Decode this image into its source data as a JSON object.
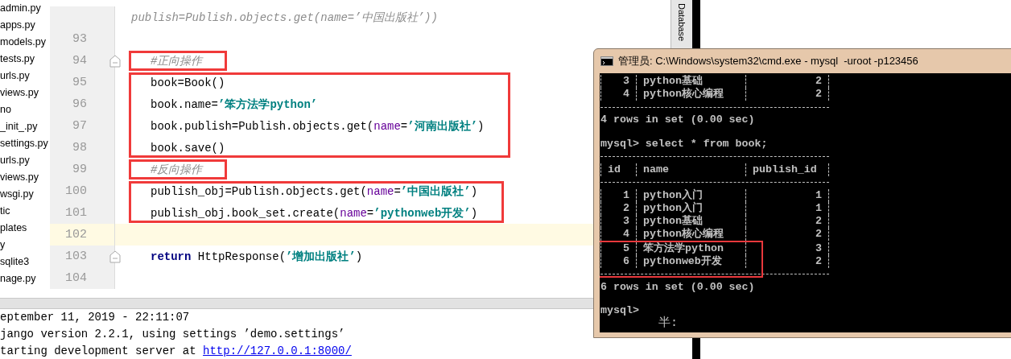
{
  "project_tree": {
    "items": [
      "admin.py",
      "apps.py",
      "models.py",
      "tests.py",
      "urls.py",
      "views.py",
      "no",
      "_init_.py",
      "settings.py",
      "urls.py",
      "views.py",
      "wsgi.py",
      "tic",
      "plates",
      "y",
      "sqlite3",
      "nage.py"
    ]
  },
  "editor": {
    "blocks": [
      {
        "boxed": false,
        "lines": [
          {
            "fold": false,
            "current": false,
            "segments": [
              {
                "kind": "comment",
                "text": "publish=Publish.objects.get(name=’中国出版社’))"
              }
            ]
          },
          {
            "number": "93",
            "fold": false,
            "current": false
          }
        ]
      },
      {
        "boxed": true,
        "lines": [
          {
            "number": "94",
            "fold": true,
            "current": false,
            "segments": [
              {
                "kind": "comment",
                "text": "#正向操作"
              }
            ]
          }
        ]
      },
      {
        "boxed": true,
        "lines": [
          {
            "number": "95",
            "fold": false,
            "current": false,
            "segments": [
              {
                "kind": "plain",
                "text": "book=Book()"
              }
            ]
          },
          {
            "number": "96",
            "fold": false,
            "current": false,
            "segments": [
              {
                "kind": "plain",
                "text": "book.name="
              },
              {
                "kind": "string",
                "text": "’笨方法学python’"
              }
            ]
          },
          {
            "number": "97",
            "fold": false,
            "current": false,
            "segments": [
              {
                "kind": "plain",
                "text": "book.publish=Publish.objects.get("
              },
              {
                "kind": "param",
                "text": "name"
              },
              {
                "kind": "plain",
                "text": "="
              },
              {
                "kind": "string",
                "text": "’河南出版社’"
              },
              {
                "kind": "plain",
                "text": ")"
              }
            ]
          },
          {
            "number": "98",
            "fold": false,
            "current": false,
            "segments": [
              {
                "kind": "plain",
                "text": "book.save()"
              }
            ]
          }
        ]
      },
      {
        "boxed": true,
        "lines": [
          {
            "number": "99",
            "fold": false,
            "current": false,
            "segments": [
              {
                "kind": "comment",
                "text": "#反向操作"
              }
            ]
          }
        ]
      },
      {
        "boxed": true,
        "lines": [
          {
            "number": "100",
            "fold": false,
            "current": false,
            "segments": [
              {
                "kind": "plain",
                "text": "publish_obj=Publish.objects.get("
              },
              {
                "kind": "param",
                "text": "name"
              },
              {
                "kind": "plain",
                "text": "="
              },
              {
                "kind": "string",
                "text": "’中国出版社’"
              },
              {
                "kind": "plain",
                "text": ")"
              }
            ]
          },
          {
            "number": "101",
            "fold": false,
            "current": false,
            "segments": [
              {
                "kind": "plain",
                "text": "publish_obj.book_set.create("
              },
              {
                "kind": "param",
                "text": "name"
              },
              {
                "kind": "plain",
                "text": "="
              },
              {
                "kind": "string",
                "text": "’pythonweb开发’"
              },
              {
                "kind": "plain",
                "text": ")"
              }
            ]
          }
        ]
      },
      {
        "boxed": false,
        "lines": [
          {
            "number": "102",
            "fold": false,
            "current": true
          },
          {
            "number": "103",
            "fold": true,
            "current": false,
            "segments": [
              {
                "kind": "keyword",
                "text": "return"
              },
              {
                "kind": "plain",
                "text": " HttpResponse("
              },
              {
                "kind": "string",
                "text": "’增加出版社’"
              },
              {
                "kind": "plain",
                "text": ")"
              }
            ]
          },
          {
            "number": "104",
            "fold": false,
            "current": false
          }
        ]
      }
    ]
  },
  "side_tab": {
    "label": "Database"
  },
  "console": {
    "lines": [
      {
        "text": "eptember 11, 2019 - 22:11:07"
      },
      {
        "text": "jango version 2.2.1, using settings ’demo.settings’"
      },
      {
        "text": "tarting development server at ",
        "link": "http://127.0.0.1:8000/"
      }
    ]
  },
  "terminal": {
    "title": "管理员: C:\\Windows\\system32\\cmd.exe - mysql  -uroot -p123456",
    "blocks": [
      {
        "kind": "table",
        "row_groups": [
          {
            "boxed": false,
            "rows": [
              [
                "3",
                "python基础",
                "2"
              ],
              [
                "4",
                "python核心编程",
                "2"
              ]
            ]
          }
        ]
      },
      {
        "kind": "text",
        "text": "4 rows in set (0.00 sec)"
      },
      {
        "kind": "blank"
      },
      {
        "kind": "text",
        "text": "mysql> select * from book;"
      },
      {
        "kind": "table",
        "columns": [
          "id",
          "name",
          "publish_id"
        ],
        "row_groups": [
          {
            "boxed": false,
            "rows": [
              [
                "1",
                "python入门",
                "1"
              ],
              [
                "2",
                "python入门",
                "1"
              ],
              [
                "3",
                "python基础",
                "2"
              ],
              [
                "4",
                "python核心编程",
                "2"
              ]
            ]
          },
          {
            "boxed": true,
            "rows": [
              [
                "5",
                "笨方法学python",
                "3"
              ],
              [
                "6",
                "pythonweb开发",
                "2"
              ]
            ]
          }
        ]
      },
      {
        "kind": "text",
        "text": "6 rows in set (0.00 sec)"
      },
      {
        "kind": "blank"
      },
      {
        "kind": "text",
        "text": "mysql>"
      },
      {
        "kind": "ime",
        "text": "半:"
      }
    ]
  }
}
